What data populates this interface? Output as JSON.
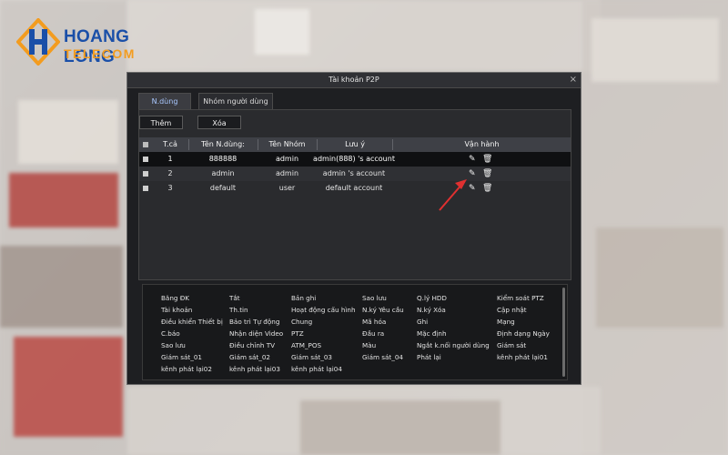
{
  "brand": {
    "line1": "HOANG LONG",
    "line2": "TELECOM"
  },
  "dialog": {
    "title": "Tài khoản P2P",
    "close_glyph": "×",
    "tabs": [
      "N.dùng",
      "Nhóm người dùng"
    ],
    "buttons": {
      "add": "Thêm",
      "delete": "Xóa"
    },
    "table": {
      "headers": [
        "T.cả",
        "Tên N.dùng:",
        "Tên Nhóm",
        "Lưu ý",
        "Vận hành"
      ],
      "rows": [
        {
          "index": "1",
          "user": "888888",
          "group": "admin",
          "note": "admin(888) 's account"
        },
        {
          "index": "2",
          "user": "admin",
          "group": "admin",
          "note": "admin 's account"
        },
        {
          "index": "3",
          "user": "default",
          "group": "user",
          "note": "default account"
        }
      ]
    },
    "permissions": [
      [
        "Băng ĐK",
        "Tắt",
        "Bản ghi",
        "Sao lưu",
        "Q.lý HDD",
        "Kiểm soát PTZ"
      ],
      [
        "Tài khoản",
        "Th.tin",
        "Hoạt động cấu hình",
        "N.ký Yêu cầu",
        "N.ký Xóa",
        "Cập nhật"
      ],
      [
        "Điều khiển Thiết bị",
        "Bảo trì Tự động",
        "Chung",
        "Mã hóa",
        "Ghi",
        "Mạng"
      ],
      [
        "C.báo",
        "Nhận diện Video",
        "PTZ",
        "Đầu ra",
        "Mặc định",
        "Định dạng Ngày"
      ],
      [
        "Sao lưu",
        "Điều chỉnh TV",
        "ATM_POS",
        "Màu",
        "Ngắt k.nối người dùng",
        "Giám sát"
      ],
      [
        "Giám sát_01",
        "Giám sát_02",
        "Giám sát_03",
        "Giám sát_04",
        "Phát lại",
        "kênh phát lại01"
      ],
      [
        "kênh phát lại02",
        "kênh phát lại03",
        "kênh phát lại04"
      ]
    ]
  },
  "colors": {
    "accent": "#1a4fa8",
    "accent2": "#f39c1f",
    "arrow": "#e03030"
  }
}
